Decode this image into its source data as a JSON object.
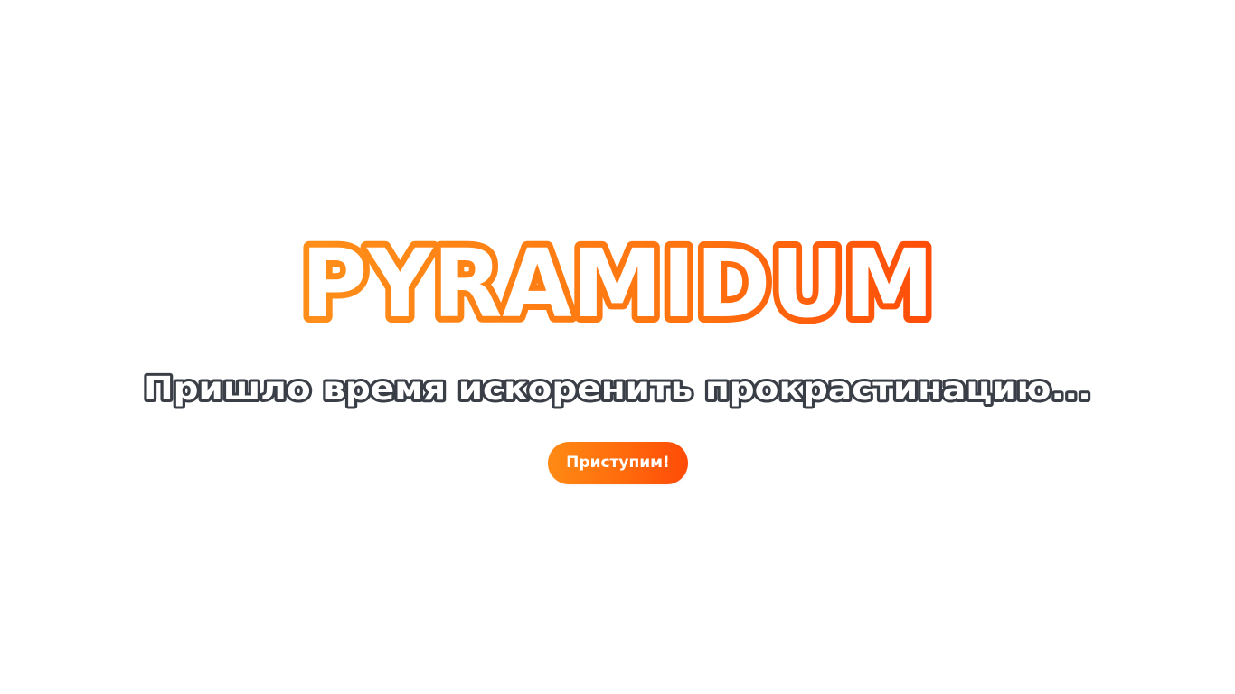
{
  "hero": {
    "logo_text": "PYRAMIDUM",
    "tagline": "Пришло время искоренить прокрастинацию...",
    "cta_label": "Приступим!"
  },
  "colors": {
    "background": "#ffffff",
    "accent_start": "#ff8a14",
    "accent_end": "#ff4a08",
    "logo_outline": "#ff7a0e",
    "tagline_fill": "#ffffff",
    "tagline_outline": "#3a3f47",
    "button_text": "#ffffff"
  }
}
